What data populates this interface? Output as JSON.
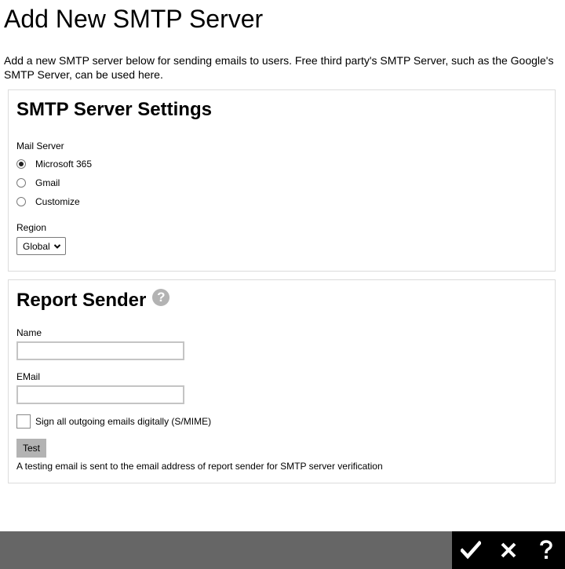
{
  "page": {
    "title": "Add New SMTP Server",
    "description": "Add a new SMTP server below for sending emails to users. Free third party's SMTP Server, such as the Google's SMTP Server, can be used here."
  },
  "smtp_settings": {
    "heading": "SMTP Server Settings",
    "mail_server_label": "Mail Server",
    "options": [
      {
        "label": "Microsoft 365",
        "checked": true
      },
      {
        "label": "Gmail",
        "checked": false
      },
      {
        "label": "Customize",
        "checked": false
      }
    ],
    "region_label": "Region",
    "region_value": "Global"
  },
  "report_sender": {
    "heading": "Report Sender",
    "name_label": "Name",
    "name_value": "",
    "email_label": "EMail",
    "email_value": "",
    "sign_label": "Sign all outgoing emails digitally (S/MIME)",
    "sign_checked": false,
    "test_button": "Test",
    "test_hint": "A testing email is sent to the email address of report sender for SMTP server verification"
  },
  "footer": {
    "actions": [
      "check-icon",
      "close-icon",
      "help-icon"
    ]
  },
  "colors": {
    "footer_bar": "#666666",
    "footer_actions": "#000000",
    "button_gray": "#b3b3b3"
  }
}
